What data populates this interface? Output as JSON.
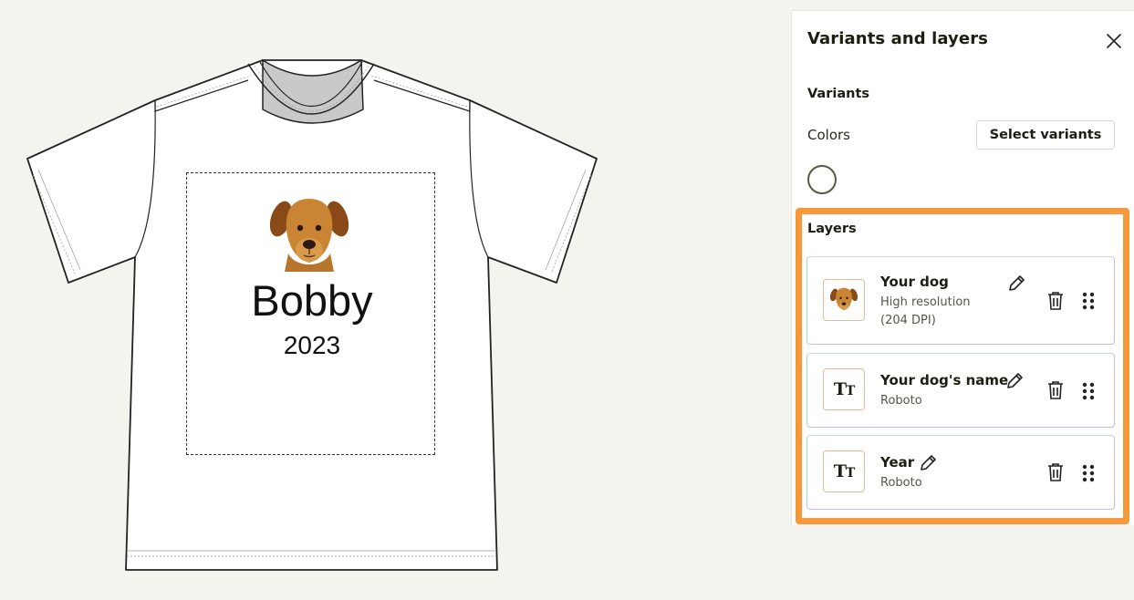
{
  "canvas": {
    "design_name": "Bobby",
    "design_year": "2023"
  },
  "panel": {
    "title": "Variants and layers",
    "close_icon": "close-icon",
    "variants_heading": "Variants",
    "colors_label": "Colors",
    "select_variants_label": "Select variants",
    "selected_color": "#ffffff",
    "layers_heading": "Layers",
    "highlight_color": "#f7993a",
    "layers": [
      {
        "name": "Your dog",
        "sub": "High resolution (204 DPI)",
        "thumb": "dog-image-thumbnail"
      },
      {
        "name": "Your dog's name",
        "sub": "Roboto",
        "thumb": "text-icon"
      },
      {
        "name": "Year",
        "sub": "Roboto",
        "thumb": "text-icon"
      }
    ]
  }
}
